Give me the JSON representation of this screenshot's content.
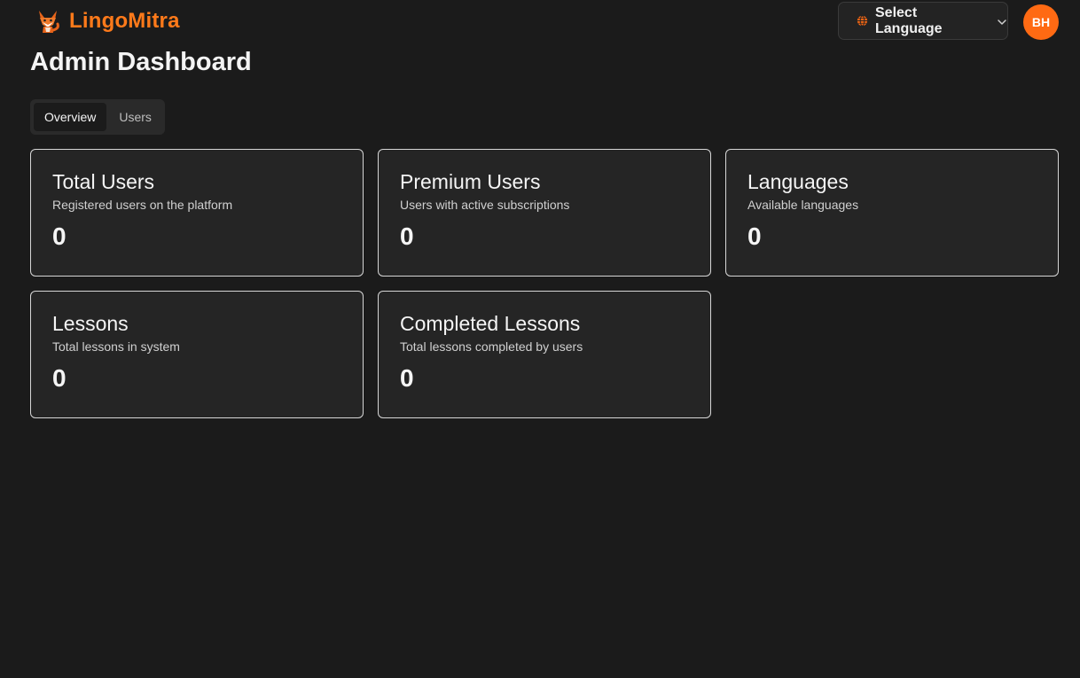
{
  "header": {
    "brand_name": "LingoMitra",
    "language_select_label": "Select Language",
    "avatar_initials": "BH"
  },
  "page": {
    "title": "Admin Dashboard"
  },
  "tabs": [
    {
      "label": "Overview",
      "active": true
    },
    {
      "label": "Users",
      "active": false
    }
  ],
  "cards": [
    {
      "title": "Total Users",
      "description": "Registered users on the platform",
      "value": "0"
    },
    {
      "title": "Premium Users",
      "description": "Users with active subscriptions",
      "value": "0"
    },
    {
      "title": "Languages",
      "description": "Available languages",
      "value": "0"
    },
    {
      "title": "Lessons",
      "description": "Total lessons in system",
      "value": "0"
    },
    {
      "title": "Completed Lessons",
      "description": "Total lessons completed by users",
      "value": "0"
    }
  ],
  "colors": {
    "brand": "#ff7a1a",
    "avatar": "#ff6a13",
    "background": "#1b1b1b",
    "card": "#252525"
  },
  "icons": {
    "logo": "fox-logo-icon",
    "language": "globe-icon",
    "dropdown": "chevron-down-icon"
  }
}
